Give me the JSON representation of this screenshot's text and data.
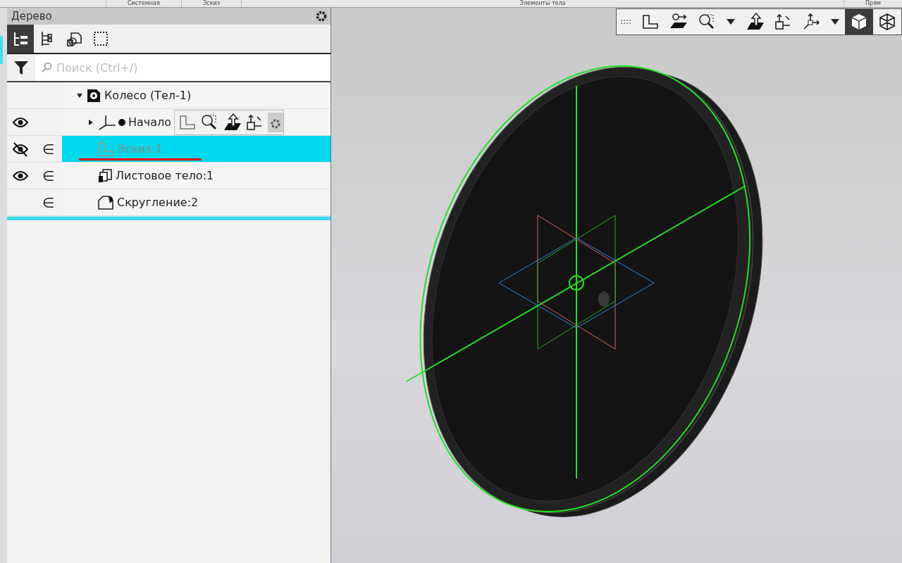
{
  "top_tabs": [
    {
      "label": "Системная"
    },
    {
      "label": "Эскиз"
    },
    {
      "label": "Элементы тела"
    },
    {
      "label": "Прям"
    }
  ],
  "panel": {
    "title": "Дерево",
    "view_buttons": [
      {
        "kind": "numbered-tree",
        "selected": true
      },
      {
        "kind": "tree",
        "selected": false
      },
      {
        "kind": "bodies",
        "selected": false
      },
      {
        "kind": "frame",
        "selected": false
      }
    ],
    "search": {
      "placeholder": "Поиск (Ctrl+/)"
    }
  },
  "tree": [
    {
      "label": "Колесо (Тел-1)",
      "kind": "part",
      "expanded": true,
      "selected": false,
      "children": [
        {
          "label": "Начало",
          "kind": "origin",
          "visible": true,
          "expanded": false,
          "selected": false,
          "has_toolbar": true
        },
        {
          "label": "Эскиз:1",
          "kind": "sketch",
          "visible": false,
          "included": "∈",
          "selected": true,
          "error": true,
          "dimmed": true
        },
        {
          "label": "Листовое тело:1",
          "kind": "sheet",
          "visible": true,
          "included": "∈",
          "selected": false
        },
        {
          "label": "Скругление:2",
          "kind": "fillet",
          "included": "∈",
          "selected": false
        }
      ]
    }
  ],
  "view_toolbar": [
    {
      "kind": "sketch"
    },
    {
      "kind": "move"
    },
    {
      "kind": "zoom"
    },
    {
      "kind": "dropdown"
    },
    {
      "kind": "normal"
    },
    {
      "kind": "orient"
    },
    {
      "kind": "axes"
    },
    {
      "kind": "dropdown"
    },
    {
      "kind": "shaded",
      "selected": true
    },
    {
      "kind": "wireframe",
      "selected": false
    }
  ]
}
